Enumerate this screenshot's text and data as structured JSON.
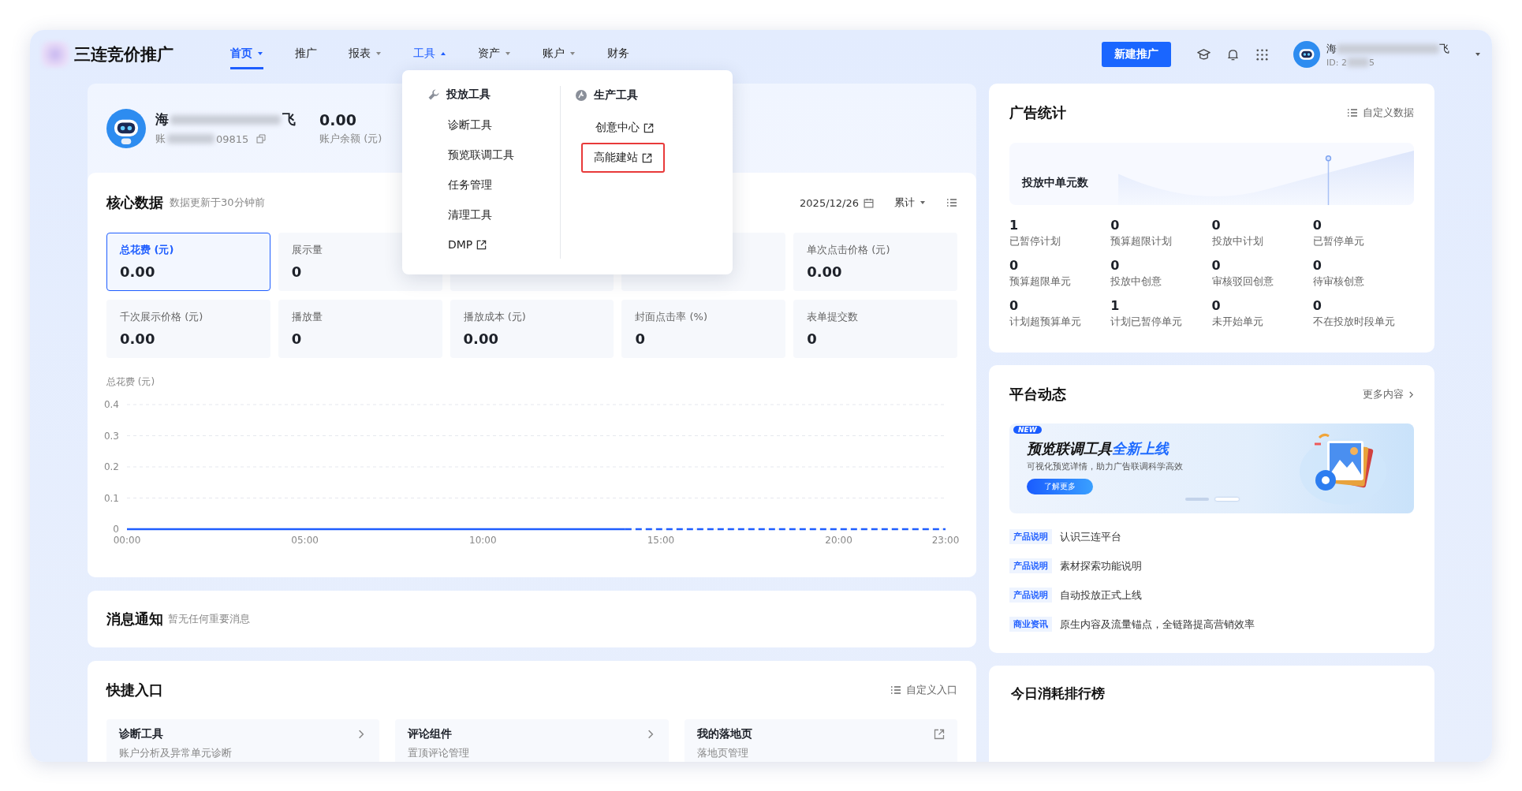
{
  "app": {
    "logo_text": "三连竞价推广"
  },
  "nav": [
    {
      "label": "首页",
      "selected": true,
      "has_menu": true,
      "expanded": false
    },
    {
      "label": "推广",
      "selected": false,
      "has_menu": false,
      "expanded": false
    },
    {
      "label": "报表",
      "selected": false,
      "has_menu": true,
      "expanded": false
    },
    {
      "label": "工具",
      "selected": false,
      "has_menu": true,
      "expanded": true
    },
    {
      "label": "资产",
      "selected": false,
      "has_menu": true,
      "expanded": false
    },
    {
      "label": "账户",
      "selected": false,
      "has_menu": true,
      "expanded": false
    },
    {
      "label": "财务",
      "selected": false,
      "has_menu": false,
      "expanded": false
    }
  ],
  "header_actions": {
    "create_button": "新建推广",
    "account": {
      "name_start": "海",
      "name_end": "飞",
      "id_start": "ID: 2",
      "id_end": "5"
    }
  },
  "tools_menu": {
    "groups": [
      {
        "title": "投放工具",
        "kind": "delivery",
        "items": [
          {
            "label": "诊断工具",
            "external": false,
            "highlighted": false
          },
          {
            "label": "预览联调工具",
            "external": false,
            "highlighted": false
          },
          {
            "label": "任务管理",
            "external": false,
            "highlighted": false
          },
          {
            "label": "清理工具",
            "external": false,
            "highlighted": false
          },
          {
            "label": "DMP",
            "external": true,
            "highlighted": false
          }
        ]
      },
      {
        "title": "生产工具",
        "kind": "production",
        "items": [
          {
            "label": "创意中心",
            "external": true,
            "highlighted": false
          },
          {
            "label": "高能建站",
            "external": true,
            "highlighted": true
          }
        ]
      }
    ]
  },
  "profile": {
    "name_start": "海",
    "name_end": "飞",
    "account_start": "账",
    "account_end": "09815",
    "balance": "0.00",
    "balance_label": "账户余额 (元)"
  },
  "core_data": {
    "title": "核心数据",
    "updated": "数据更新于30分钟前",
    "date": "2025/12/26",
    "range": "累计",
    "metrics": [
      {
        "kind": "metric",
        "label": "总花费 (元)",
        "value": "0.00",
        "selected": true
      },
      {
        "kind": "metric",
        "label": "展示量",
        "value": "0",
        "selected": false
      },
      {
        "kind": "covered",
        "selected": false
      },
      {
        "kind": "covered",
        "selected": false
      },
      {
        "kind": "metric",
        "label": "单次点击价格 (元)",
        "value": "0.00",
        "selected": false
      },
      {
        "kind": "metric",
        "label": "千次展示价格 (元)",
        "value": "0.00",
        "selected": false
      },
      {
        "kind": "metric",
        "label": "播放量",
        "value": "0",
        "selected": false
      },
      {
        "kind": "metric",
        "label": "播放成本 (元)",
        "value": "0.00",
        "selected": false
      },
      {
        "kind": "metric",
        "label": "封面点击率 (%)",
        "value": "0",
        "selected": false
      },
      {
        "kind": "metric",
        "label": "表单提交数",
        "value": "0",
        "selected": false
      }
    ],
    "chart_data": {
      "type": "line",
      "ylabel": "总花费 (元)",
      "x": [
        0,
        1,
        2,
        3,
        4,
        5,
        6,
        7,
        8,
        9,
        10,
        11,
        12,
        13,
        14,
        15,
        16,
        17,
        18,
        19,
        20,
        21,
        22,
        23
      ],
      "grid": true,
      "series": [
        {
          "color": "#1f5eff",
          "line_style": "solid",
          "values": [
            0,
            0,
            0,
            0,
            0,
            0,
            0,
            0,
            0,
            0,
            0,
            0,
            0,
            0,
            0,
            null,
            null,
            null,
            null,
            null,
            null,
            null,
            null,
            null
          ]
        },
        {
          "color": "#1f5eff",
          "line_style": "dashed",
          "values": [
            null,
            null,
            null,
            null,
            null,
            null,
            null,
            null,
            null,
            null,
            null,
            null,
            null,
            null,
            0,
            0,
            0,
            0,
            0,
            0,
            0,
            0,
            0,
            0
          ]
        }
      ],
      "xlim": [
        0,
        23
      ],
      "ylim": [
        0,
        0.4
      ],
      "xticks": [
        {
          "value": 0,
          "label": "00:00"
        },
        {
          "value": 5,
          "label": "05:00"
        },
        {
          "value": 10,
          "label": "10:00"
        },
        {
          "value": 15,
          "label": "15:00"
        },
        {
          "value": 20,
          "label": "20:00"
        },
        {
          "value": 23,
          "label": "23:00"
        }
      ],
      "yticks": [
        0,
        0.1,
        0.2,
        0.3,
        0.4
      ]
    }
  },
  "notice": {
    "title": "消息通知",
    "text": "暂无任何重要消息"
  },
  "shortcuts": {
    "title": "快捷入口",
    "action": "自定义入口",
    "items": [
      {
        "title": "诊断工具",
        "subtitle": "账户分析及异常单元诊断",
        "kind": "internal"
      },
      {
        "title": "评论组件",
        "subtitle": "置顶评论管理",
        "kind": "internal"
      },
      {
        "title": "我的落地页",
        "subtitle": "落地页管理",
        "kind": "external"
      }
    ]
  },
  "ad_stats": {
    "title": "广告统计",
    "action": "自定义数据",
    "trend_label": "投放中单元数",
    "stats": [
      {
        "value": "1",
        "label": "已暂停计划"
      },
      {
        "value": "0",
        "label": "预算超限计划"
      },
      {
        "value": "0",
        "label": "投放中计划"
      },
      {
        "value": "0",
        "label": "已暂停单元"
      },
      {
        "value": "0",
        "label": "预算超限单元"
      },
      {
        "value": "0",
        "label": "投放中创意"
      },
      {
        "value": "0",
        "label": "审核驳回创意"
      },
      {
        "value": "0",
        "label": "待审核创意"
      },
      {
        "value": "0",
        "label": "计划超预算单元"
      },
      {
        "value": "1",
        "label": "计划已暂停单元"
      },
      {
        "value": "0",
        "label": "未开始单元"
      },
      {
        "value": "0",
        "label": "不在投放时段单元"
      }
    ]
  },
  "platform_news": {
    "title": "平台动态",
    "more": "更多内容",
    "banner": {
      "badge": "NEW",
      "title": "预览联调工具",
      "title_highlight": "全新上线",
      "subtitle": "可视化预览详情，助力广告联调科学高效",
      "button": "了解更多",
      "dots": [
        {
          "selected": false
        },
        {
          "selected": true
        }
      ]
    },
    "items": [
      {
        "tag": "产品说明",
        "text": "认识三连平台"
      },
      {
        "tag": "产品说明",
        "text": "素材探索功能说明"
      },
      {
        "tag": "产品说明",
        "text": "自动投放正式上线"
      },
      {
        "tag": "商业资讯",
        "text": "原生内容及流量锚点，全链路提高营销效率"
      }
    ]
  },
  "ranking": {
    "title": "今日消耗排行榜"
  }
}
